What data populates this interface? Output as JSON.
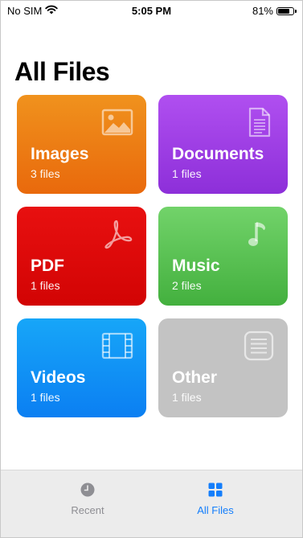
{
  "status_bar": {
    "carrier": "No SIM",
    "time": "5:05 PM",
    "battery_percent_label": "81%",
    "battery_level": 0.81,
    "wifi_icon": "wifi-icon"
  },
  "page": {
    "title": "All Files"
  },
  "categories": [
    {
      "name": "Images",
      "count_label": "3 files",
      "icon": "image-icon",
      "color": "#f0921d"
    },
    {
      "name": "Documents",
      "count_label": "1 files",
      "icon": "document-icon",
      "color": "#a845ea"
    },
    {
      "name": "PDF",
      "count_label": "1 files",
      "icon": "pdf-icon",
      "color": "#e30a0a"
    },
    {
      "name": "Music",
      "count_label": "2 files",
      "icon": "music-note-icon",
      "color": "#5dc455"
    },
    {
      "name": "Videos",
      "count_label": "1 files",
      "icon": "film-icon",
      "color": "#1192f5"
    },
    {
      "name": "Other",
      "count_label": "1 files",
      "icon": "list-icon",
      "color": "#c3c3c3"
    }
  ],
  "tab_bar": {
    "tabs": [
      {
        "label": "Recent",
        "icon": "clock-icon",
        "active": false
      },
      {
        "label": "All Files",
        "icon": "grid-icon",
        "active": true
      }
    ],
    "active_color": "#147efb",
    "inactive_color": "#8e8e93"
  }
}
